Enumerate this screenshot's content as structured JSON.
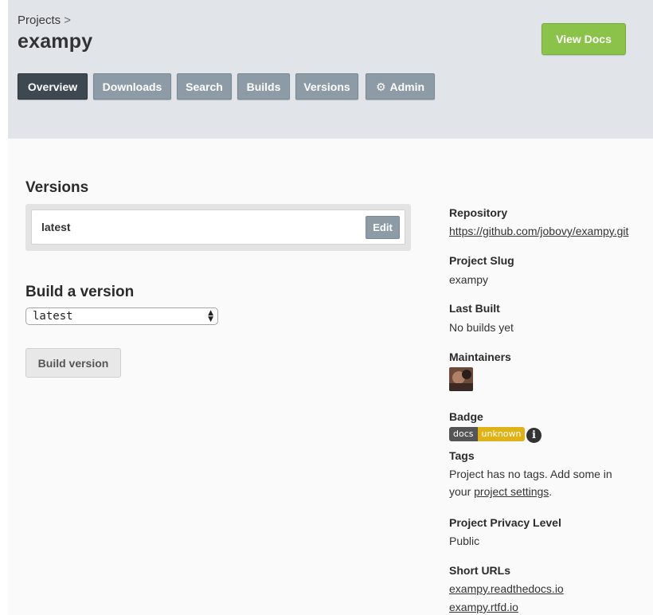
{
  "header": {
    "breadcrumb": "Projects",
    "breadcrumb_sep": ">",
    "project_name": "exampy",
    "view_docs_label": "View Docs",
    "tabs": [
      {
        "label": "Overview",
        "active": true
      },
      {
        "label": "Downloads"
      },
      {
        "label": "Search"
      },
      {
        "label": "Builds"
      },
      {
        "label": "Versions"
      },
      {
        "label": "Admin",
        "icon": "gear-icon"
      }
    ]
  },
  "versions": {
    "title": "Versions",
    "items": [
      {
        "name": "latest",
        "edit_label": "Edit"
      }
    ]
  },
  "build": {
    "title": "Build a version",
    "selected": "latest",
    "button_label": "Build version"
  },
  "sidebar": {
    "repository_label": "Repository",
    "repository_url": "https://github.com/jobovy/exampy.git",
    "slug_label": "Project Slug",
    "slug_value": "exampy",
    "last_built_label": "Last Built",
    "last_built_value": "No builds yet",
    "maintainers_label": "Maintainers",
    "badge_label": "Badge",
    "badge_left": "docs",
    "badge_right": "unknown",
    "tags_label": "Tags",
    "tags_text_1": "Project has no tags. Add some in",
    "tags_text_2": "your ",
    "tags_link": "project settings",
    "tags_text_3": ".",
    "privacy_label": "Project Privacy Level",
    "privacy_value": "Public",
    "short_urls_label": "Short URLs",
    "short_urls": [
      "exampy.readthedocs.io",
      "exampy.rtfd.io"
    ]
  },
  "colors": {
    "header_bg": "#e1e5ea",
    "tab_bg": "#8d9ba7",
    "tab_active_bg": "#3e4850",
    "view_docs_bg": "#8bc34a",
    "badge_unknown": "#dfb317"
  }
}
